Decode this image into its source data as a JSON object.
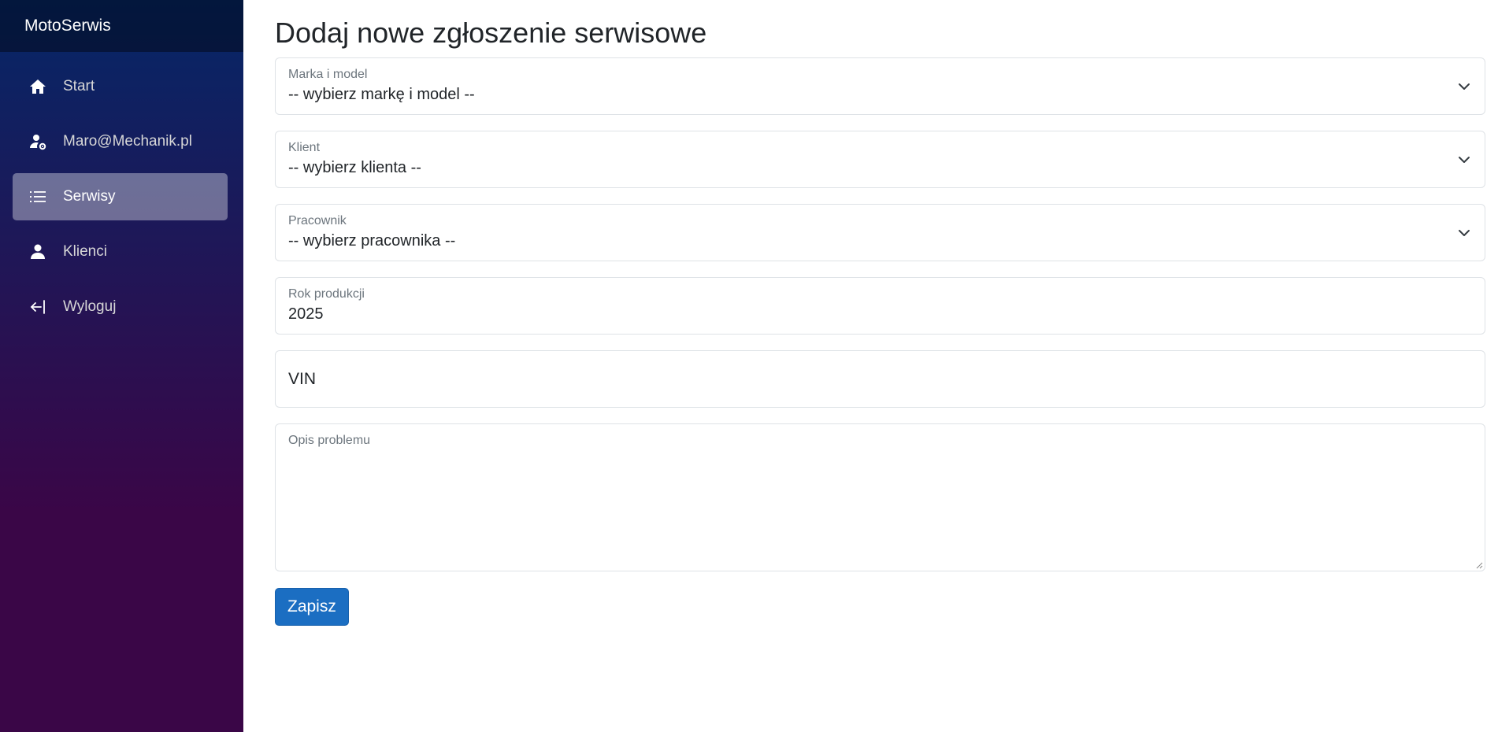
{
  "app": {
    "brand": "MotoSerwis"
  },
  "sidebar": {
    "items": [
      {
        "label": "Start",
        "icon": "home-icon",
        "active": false
      },
      {
        "label": "Maro@Mechanik.pl",
        "icon": "user-gear-icon",
        "active": false
      },
      {
        "label": "Serwisy",
        "icon": "list-icon",
        "active": true
      },
      {
        "label": "Klienci",
        "icon": "person-icon",
        "active": false
      },
      {
        "label": "Wyloguj",
        "icon": "logout-icon",
        "active": false
      }
    ]
  },
  "main": {
    "title": "Dodaj nowe zgłoszenie serwisowe",
    "fields": {
      "brand_model": {
        "label": "Marka i model",
        "value": "-- wybierz markę i model --"
      },
      "client": {
        "label": "Klient",
        "value": "-- wybierz klienta --"
      },
      "employee": {
        "label": "Pracownik",
        "value": "-- wybierz pracownika --"
      },
      "year": {
        "label": "Rok produkcji",
        "value": "2025"
      },
      "vin": {
        "placeholder": "VIN",
        "value": ""
      },
      "description": {
        "label": "Opis problemu",
        "value": ""
      }
    },
    "save_label": "Zapisz"
  },
  "colors": {
    "sidebar_top": "#052767",
    "sidebar_bottom": "#3a0647",
    "primary_button": "#1b6ec2"
  }
}
